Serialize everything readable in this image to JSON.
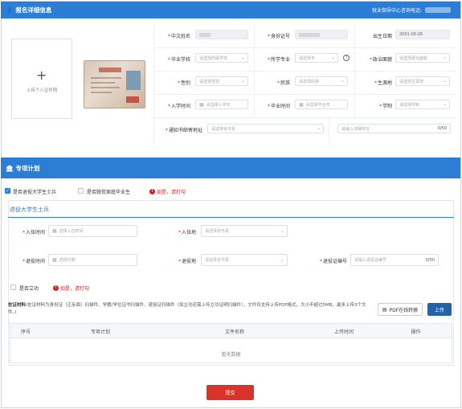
{
  "header1": {
    "title": "报名详细信息",
    "hotline_label": "就业指导中心咨询电话:"
  },
  "upload": {
    "label": "上传个人证件照"
  },
  "basic": {
    "name_label": "中文姓名",
    "id_label": "身份证号",
    "dob_label": "出生日期",
    "dob_value": "2001-06-26",
    "school_label": "毕业学校",
    "school_placeholder": "请选择所属学校",
    "major_label": "所学专业",
    "major_placeholder": "请选择专",
    "politics_label": "政治面貌",
    "politics_placeholder": "请选择政治面貌",
    "gender_label": "性别",
    "gender_placeholder": "请选择性别",
    "ethnic_label": "民族",
    "ethnic_placeholder": "请选择民族",
    "origin_label": "生源地",
    "origin_placeholder": "请选择生源地",
    "enroll_label": "入学时间",
    "enroll_placeholder": "请选择入学年",
    "grad_label": "毕业时间",
    "grad_placeholder": "请选择毕业年",
    "system_label": "学制",
    "system_placeholder": "请选择学制",
    "address_label": "通知书邮寄地址",
    "address_placeholder": "请选择省市县",
    "address_detail_placeholder": "请输入详细地址",
    "address_count": "0/50"
  },
  "header2": {
    "title": "专项计划"
  },
  "plans": {
    "veteran_label": "是否退役大学生士兵",
    "poverty_label": "是否脱贫家庭毕业生",
    "warn_text": "如是，请打勾"
  },
  "veteran": {
    "section_title": "退役大学生士兵",
    "enlist_time_label": "入伍时间",
    "enlist_time_placeholder": "选择入伍时间",
    "enlist_place_label": "入伍地",
    "enlist_place_placeholder": "请选择省市县",
    "retire_time_label": "退役时间",
    "retire_time_placeholder": "选择日期",
    "retire_place_label": "退役地",
    "retire_place_placeholder": "请选择省市县",
    "cert_label": "退役证编号",
    "cert_placeholder": "请输入退役证编号",
    "cert_count": "0/50",
    "merit_label": "是否立功",
    "warn_text": "如是，请打勾"
  },
  "evidence": {
    "title": "佐证材料",
    "note": "(佐证材料为身份证（正反面）扫描件、学籍/学位证书扫描件、退役证扫描件（如立功还需上传立功证明扫描件），文件仅支持上传PDF格式，大小不超过5MB，最多上传3个文件。)",
    "pdf_button": "PDF在线转换",
    "upload_button": "上传"
  },
  "table": {
    "columns": [
      "序号",
      "专项计划",
      "文件名称",
      "上传时间",
      "操作"
    ],
    "empty": "暂无数据"
  },
  "submit": "提交"
}
